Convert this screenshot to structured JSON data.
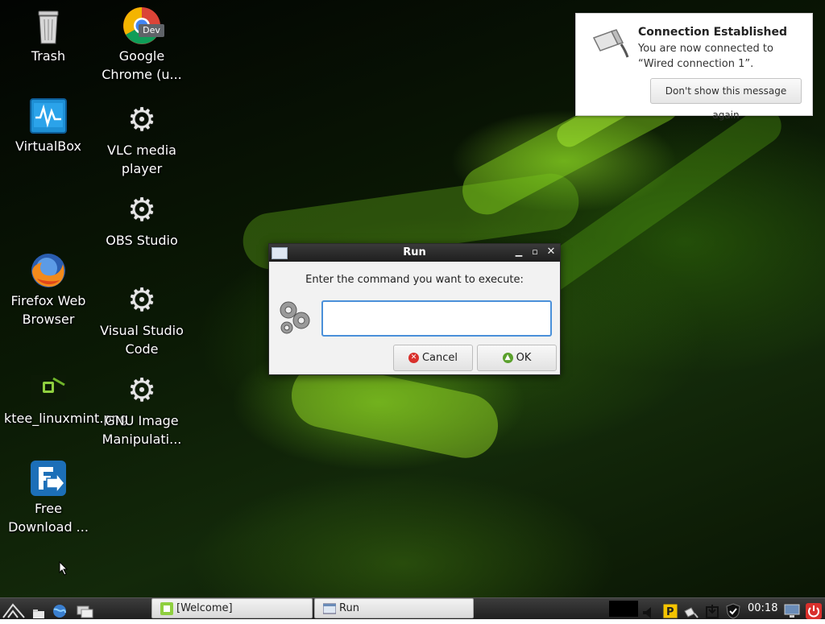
{
  "desktop": {
    "icons": [
      {
        "label": "Trash",
        "icon": "trash-icon"
      },
      {
        "label": "Google Chrome (u...",
        "icon": "chrome-dev-icon",
        "badge": "Dev"
      },
      {
        "label": "VirtualBox",
        "icon": "virtualbox-icon"
      },
      {
        "label": "VLC media player",
        "icon": "gear-icon"
      },
      {
        "label": "OBS Studio",
        "icon": "gear-icon"
      },
      {
        "label": "Firefox Web Browser",
        "icon": "firefox-icon"
      },
      {
        "label": "Visual Studio Code",
        "icon": "gear-icon"
      },
      {
        "label": "ktee_linuxmint.png",
        "icon": "image-thumbnail-icon"
      },
      {
        "label": "GNU Image Manipulati...",
        "icon": "gear-icon"
      },
      {
        "label": "Free Download ...",
        "icon": "free-download-manager-icon"
      }
    ]
  },
  "notification": {
    "title": "Connection Established",
    "body": "You are now connected to “Wired connection 1”.",
    "button": "Don't show this message again"
  },
  "run_dialog": {
    "title": "Run",
    "prompt": "Enter the command you want to execute:",
    "command_value": "",
    "cancel_label": "Cancel",
    "ok_label": "OK"
  },
  "taskbar": {
    "tasks": [
      {
        "label": "[Welcome]",
        "icon": "mint-welcome-icon"
      },
      {
        "label": "Run",
        "icon": "window-icon"
      }
    ],
    "clock": "00:18"
  },
  "colors": {
    "accent_focus": "#4a90d9",
    "cancel_red": "#d9302c",
    "ok_green": "#5aa02c",
    "mint_green": "#8fcf3f"
  }
}
